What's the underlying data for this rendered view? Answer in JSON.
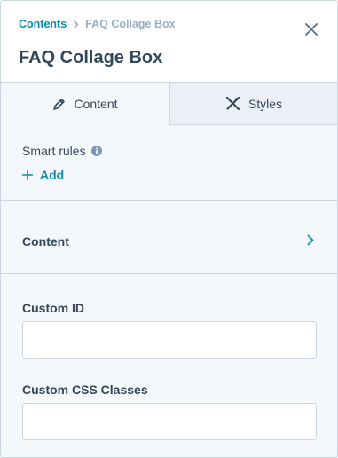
{
  "breadcrumb": {
    "parent": "Contents",
    "current": "FAQ Collage Box"
  },
  "header": {
    "title": "FAQ Collage Box"
  },
  "tabs": [
    {
      "label": "Content",
      "icon": "pencil-icon",
      "active": true
    },
    {
      "label": "Styles",
      "icon": "styles-tools-icon",
      "active": false
    }
  ],
  "smart_rules": {
    "label": "Smart rules",
    "add_label": "Add"
  },
  "content_section": {
    "label": "Content"
  },
  "fields": {
    "custom_id": {
      "label": "Custom ID",
      "value": ""
    },
    "custom_css": {
      "label": "Custom CSS Classes",
      "value": ""
    }
  },
  "colors": {
    "accent": "#0091ae",
    "text": "#33475b",
    "border": "#cbd6e2",
    "panel_bg": "#f5f8fa",
    "inactive_tab_bg": "#eaf0f6"
  }
}
